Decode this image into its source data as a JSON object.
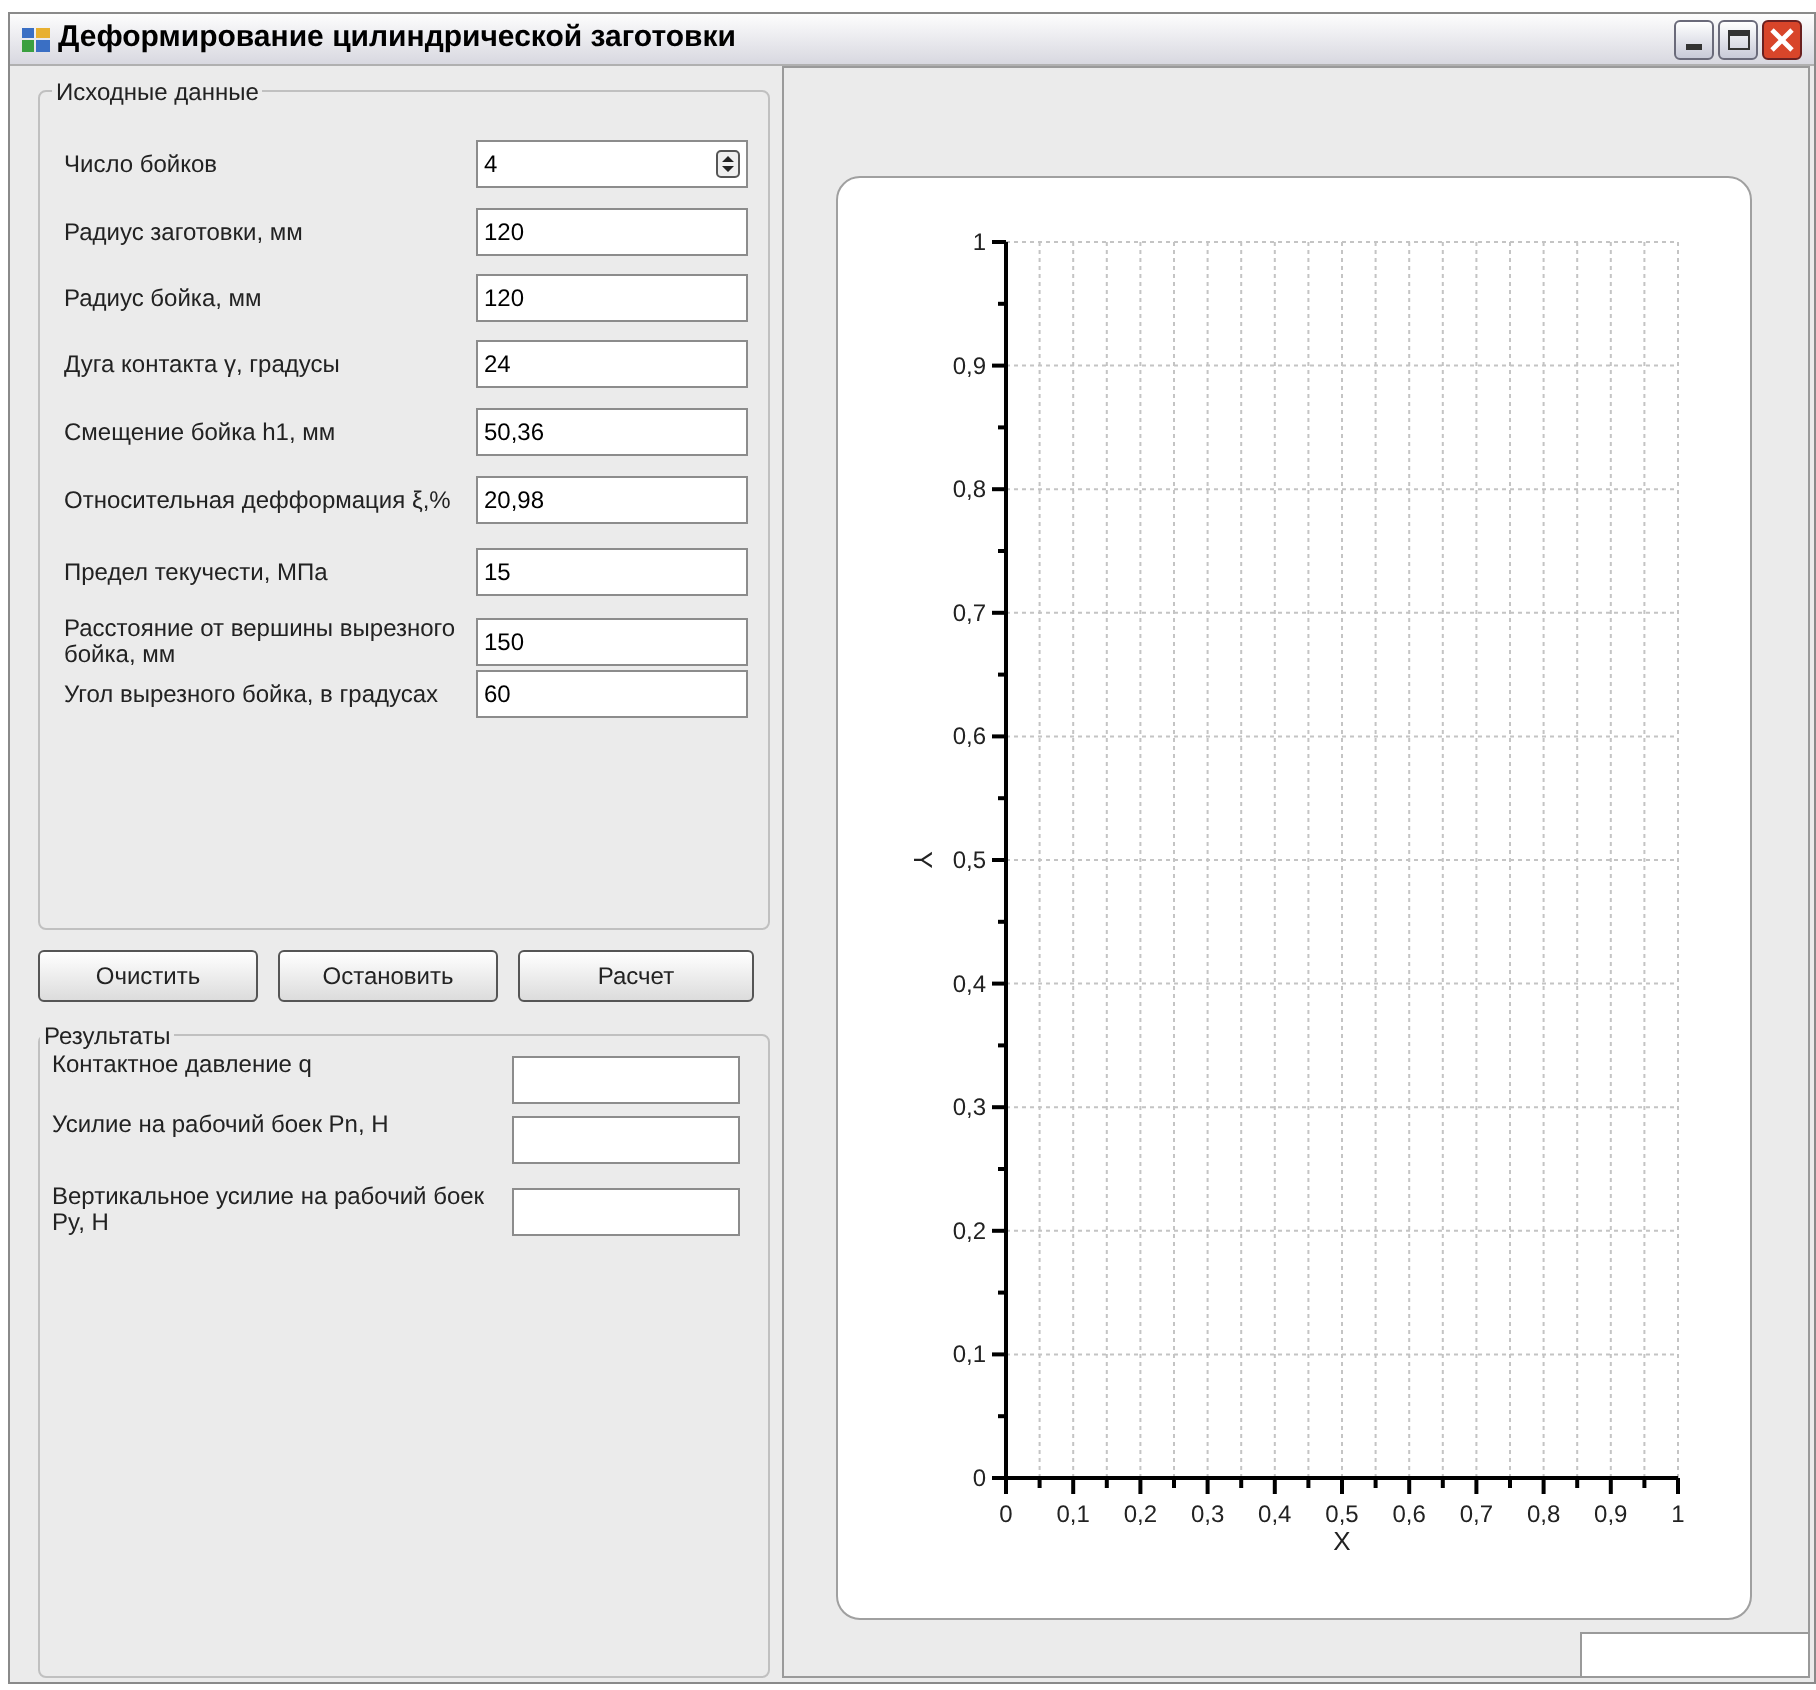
{
  "window": {
    "title": "Деформирование цилиндрической заготовки"
  },
  "input_group": {
    "title": "Исходные данные",
    "fields": [
      {
        "kind": "spin",
        "label": "Число бойков",
        "value": "4"
      },
      {
        "kind": "text",
        "label": "Радиус заготовки, мм",
        "value": "120"
      },
      {
        "kind": "text",
        "label": "Радиус бойка, мм",
        "value": "120"
      },
      {
        "kind": "text",
        "label": "Дуга контакта γ, градусы",
        "value": "24"
      },
      {
        "kind": "text",
        "label": "Смещение бойка h1, мм",
        "value": "50,36"
      },
      {
        "kind": "text",
        "label": "Относительная дефформация ξ,%",
        "value": "20,98"
      },
      {
        "kind": "text",
        "label": "Предел текучести, МПа",
        "value": "15"
      },
      {
        "kind": "text",
        "label": "Расстояние от вершины вырезного бойка, мм",
        "value": "150"
      },
      {
        "kind": "text",
        "label": "Угол вырезного бойка, в градусах",
        "value": "60"
      }
    ]
  },
  "buttons": [
    "Очистить",
    "Остановить",
    "Расчет"
  ],
  "results_group": {
    "title": "Результаты",
    "fields": [
      {
        "label": "Контактное давление q"
      },
      {
        "label": "Усилие на рабочий боек Pn, Н"
      },
      {
        "label": "Вертикальное усилие на рабочий боек Py, Н"
      }
    ]
  },
  "chart": {
    "chart_data": {
      "type": "line",
      "grid": true,
      "xlabel": "X",
      "ylabel": "Y",
      "xlim": [
        0,
        1
      ],
      "ylim": [
        0,
        1
      ],
      "xticks": [
        0,
        {
          "value": 0.1,
          "label": "0,1"
        },
        {
          "value": 0.2,
          "label": "0,2"
        },
        {
          "value": 0.3,
          "label": "0,3"
        },
        {
          "value": 0.4,
          "label": "0,4"
        },
        {
          "value": 0.5,
          "label": "0,5"
        },
        {
          "value": 0.6,
          "label": "0,6"
        },
        {
          "value": 0.7,
          "label": "0,7"
        },
        {
          "value": 0.8,
          "label": "0,8"
        },
        {
          "value": 0.9,
          "label": "0,9"
        },
        1
      ],
      "yticks": [
        0,
        {
          "value": 0.1,
          "label": "0,1"
        },
        {
          "value": 0.2,
          "label": "0,2"
        },
        {
          "value": 0.3,
          "label": "0,3"
        },
        {
          "value": 0.4,
          "label": "0,4"
        },
        {
          "value": 0.5,
          "label": "0,5"
        },
        {
          "value": 0.6,
          "label": "0,6"
        },
        {
          "value": 0.7,
          "label": "0,7"
        },
        {
          "value": 0.8,
          "label": "0,8"
        },
        {
          "value": 0.9,
          "label": "0,9"
        },
        1
      ]
    }
  }
}
